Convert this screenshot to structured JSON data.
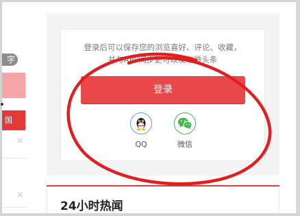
{
  "left_column": {
    "tag_text": "字",
    "red_banner_text": "国",
    "close_symbol": "×"
  },
  "login_panel": {
    "hint_line1": "登录后可以保存您的浏览喜好、评论、收藏，",
    "hint_line2": "并与APP同步更可以发布微头条",
    "login_button": "登录",
    "social": [
      {
        "label": "QQ",
        "icon": "qq-penguin-icon",
        "color": "#5aa0e0"
      },
      {
        "label": "微信",
        "icon": "wechat-icon",
        "color": "#46b64c"
      }
    ]
  },
  "hot_news": {
    "title": "24小时热闻",
    "accent_color": "#e23a3a"
  },
  "annotation": {
    "color": "#e02020",
    "shape": "ellipse"
  }
}
